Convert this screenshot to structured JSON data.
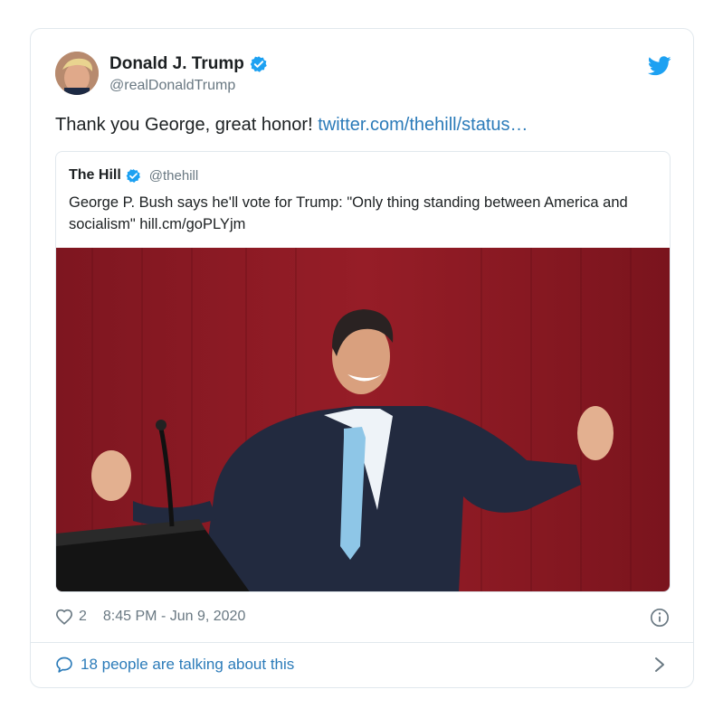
{
  "tweet": {
    "author_name": "Donald J. Trump",
    "author_handle": "@realDonaldTrump",
    "text": "Thank you George, great honor! ",
    "link_text": "twitter.com/thehill/status…",
    "quoted": {
      "author_name": "The Hill",
      "author_handle": "@thehill",
      "text": "George P. Bush says he'll vote for Trump: \"Only thing standing between America and socialism\" hill.cm/goPLYjm"
    },
    "like_count": "2",
    "timestamp": "8:45 PM - Jun 9, 2020",
    "talking": "18 people are talking about this"
  },
  "icons": {
    "verified": "verified-badge-icon",
    "bird": "twitter-bird-icon",
    "heart": "heart-icon",
    "info": "info-icon",
    "bubble": "comment-bubble-icon",
    "chevron": "chevron-right-icon"
  },
  "colors": {
    "accent": "#1da1f2",
    "link": "#2b7bb9",
    "muted": "#697882",
    "border": "#e1e8ed",
    "curtain": "#8a1a22"
  }
}
